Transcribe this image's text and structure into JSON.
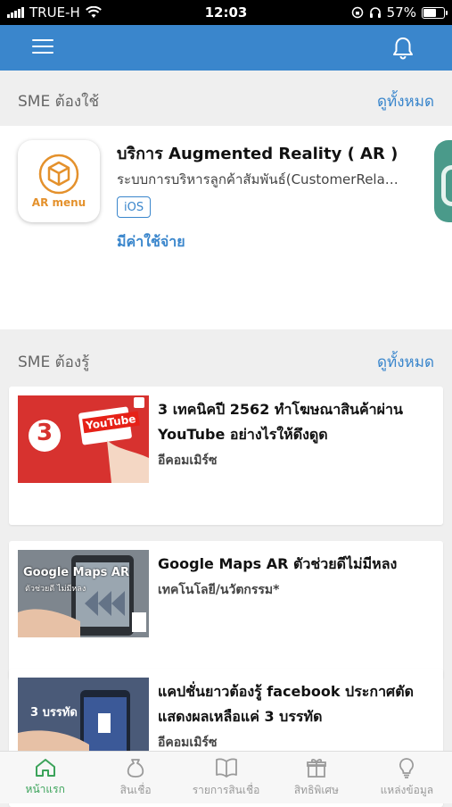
{
  "status_bar": {
    "carrier": "TRUE-H",
    "time": "12:03",
    "battery": "57%"
  },
  "section_sme_use": {
    "title": "SME ต้องใช้",
    "see_all": "ดูทั้งหมด",
    "service": {
      "icon_label": "AR menu",
      "title": "บริการ Augmented Reality ( AR )",
      "description": "ระบบการบริหารลูกค้าสัมพันธ์(CustomerRelationship",
      "platform": "iOS",
      "price": "มีค่าใช้จ่าย"
    }
  },
  "section_sme_know": {
    "title": "SME ต้องรู้",
    "see_all": "ดูทั้งหมด",
    "articles": [
      {
        "title": "3 เทคนิคปี 2562 ทำโฆษณาสินค้าผ่าน YouTube อย่างไรให้ดึงดูด",
        "category": "อีคอมเมิร์ซ",
        "thumb_text": "YouTube",
        "thumb_number": "3"
      },
      {
        "title": "Google Maps AR ตัวช่วยดีไม่มีหลง",
        "category": "เทคโนโลยี/นวัตกรรม*",
        "thumb_text": "Google Maps AR",
        "thumb_sub": "ตัวช่วยดี ไม่มีหลง"
      },
      {
        "title": "แคปชั่นยาวต้องรู้ facebook ประกาศตัดแสดงผลเหลือแค่ 3 บรรทัด",
        "category": "อีคอมเมิร์ซ",
        "thumb_text": "3 บรรทัด"
      }
    ]
  },
  "bottom_nav": [
    {
      "label": "หน้าแรก",
      "icon": "home-icon",
      "active": true
    },
    {
      "label": "สินเชื่อ",
      "icon": "money-bag-icon",
      "active": false
    },
    {
      "label": "รายการสินเชื่อ",
      "icon": "book-icon",
      "active": false
    },
    {
      "label": "สิทธิพิเศษ",
      "icon": "gift-icon",
      "active": false
    },
    {
      "label": "แหล่งข้อมูล",
      "icon": "lightbulb-icon",
      "active": false
    }
  ],
  "colors": {
    "primary": "#3a86cc",
    "active_nav": "#3ba35a",
    "ar_orange": "#e4912c"
  }
}
